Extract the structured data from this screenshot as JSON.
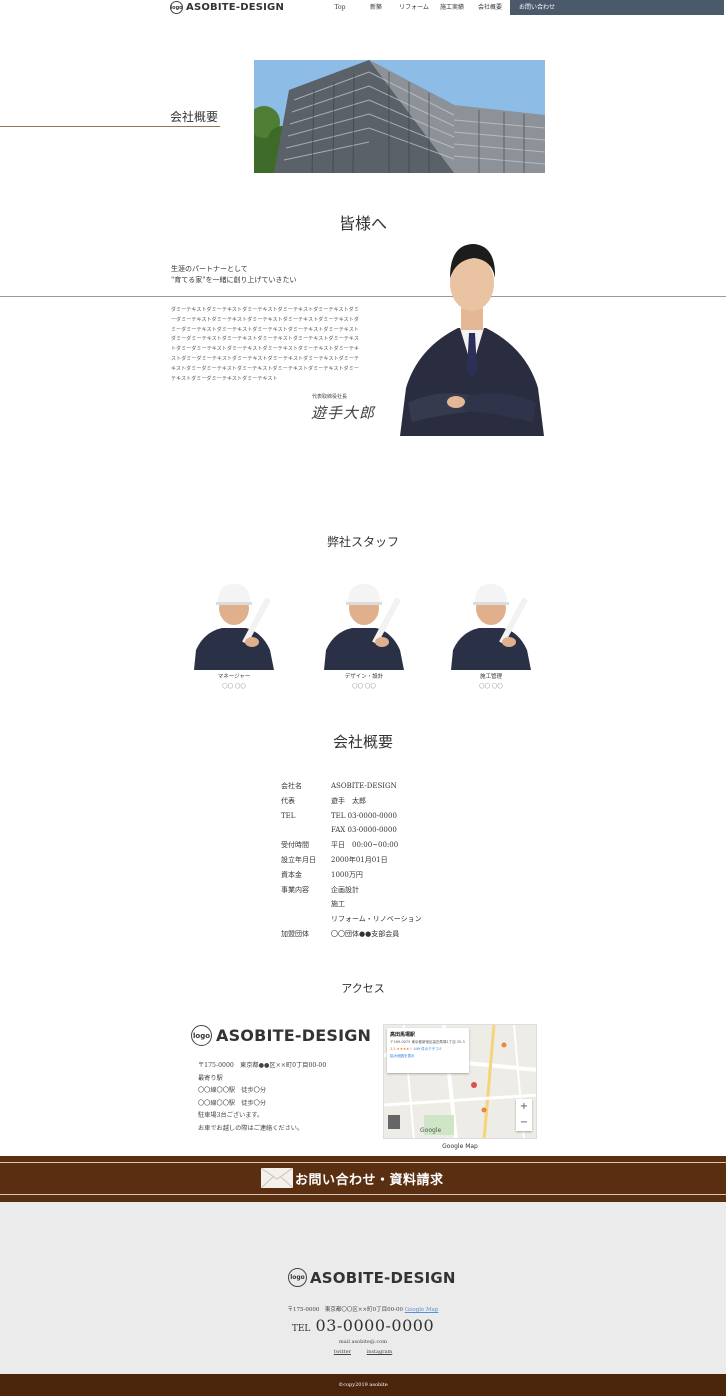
{
  "header": {
    "logo_mark": "logo",
    "logo_text": "ASOBITE-DESIGN",
    "nav": [
      "Top",
      "新築",
      "リフォーム",
      "施工実績",
      "会社概要"
    ],
    "contact": "お問い合わせ"
  },
  "hero": {
    "page_heading": "会社概要"
  },
  "greeting": {
    "title": "皆様へ",
    "sub_line1": "生涯のパートナーとして",
    "sub_line2": "\"育てる家\"を一緒に創り上げていきたい",
    "body": "ダミーテキストダミーテキストダミーテキストダミーテキストダミーテキストダミーダミーテキストダミーテキストダミーテキストダミーテキストダミーテキストダミーダミーテキストダミーテキストダミーテキストダミーテキストダミーテキストダミーダミーテキストダミーテキストダミーテキストダミーテキストダミーテキストダミーダミーテキストダミーテキストダミーテキストダミーテキストダミーテキストダミーダミーテキストダミーテキストダミーテキストダミーテキストダミーテキストダミーダミーテキストダミーテキストダミーテキストダミーテキストダミーテキストダミーダミーテキストダミーテキスト",
    "ceo_role": "代表取締役社長",
    "ceo_signature": "遊手大郎"
  },
  "staff": {
    "title": "弊社スタッフ",
    "members": [
      {
        "role": "マネージャー",
        "name": "〇〇 〇〇"
      },
      {
        "role": "デザイン・設計",
        "name": "〇〇 〇〇"
      },
      {
        "role": "施工管理",
        "name": "〇〇 〇〇"
      }
    ]
  },
  "company": {
    "title": "会社概要",
    "rows": [
      {
        "label": "会社名",
        "value": "ASOBITE-DESIGN"
      },
      {
        "label": "代表",
        "value": "遊手　太郎"
      },
      {
        "label": "TEL",
        "value": "TEL 03-0000-0000"
      },
      {
        "label": "",
        "value": "FAX 03-0000-0000"
      },
      {
        "label": "受付時間",
        "value": "平日　00:00~00:00"
      },
      {
        "label": "設立年月日",
        "value": "2000年01月01日"
      },
      {
        "label": "資本金",
        "value": "1000万円"
      },
      {
        "label": "事業内容",
        "value": "企画設計"
      },
      {
        "label": "",
        "value": "施工"
      },
      {
        "label": "",
        "value": "リフォーム・リノベーション"
      },
      {
        "label": "加盟団体",
        "value": "〇〇団体●●支部会員"
      }
    ]
  },
  "access": {
    "title": "アクセス",
    "logo_mark": "logo",
    "logo_text": "ASOBITE-DESIGN",
    "lines": [
      "〒175-0000　東京都●●区××町0丁目00-00",
      "最寄り駅",
      "〇〇線〇〇駅　徒歩〇分",
      "〇〇線〇〇駅　徒歩〇分",
      "駐車場3台ございます。",
      "お車でお越しの際はご連絡ください。"
    ],
    "map": {
      "place": "高田馬場駅",
      "address": "〒169-0075 東京都新宿区高田馬場1丁目 35-3",
      "rating": "3.5 ★★★★☆",
      "reviews": "449 件のクチコミ",
      "enlarge": "拡大地図を表示",
      "zoom_in": "+",
      "zoom_out": "−",
      "google": "Google",
      "caption": "Google Map"
    }
  },
  "contact_banner": {
    "label": "お問い合わせ・資料請求"
  },
  "footer": {
    "logo_mark": "logo",
    "logo_text": "ASOBITE-DESIGN",
    "address": "〒175-0000　東京都〇〇区××町0丁目00-00",
    "map_link": "Google Map",
    "tel_label": "TEL",
    "tel_number": "03-0000-0000",
    "email": "mail asobite@.com",
    "social": [
      "twitter",
      "instagram"
    ],
    "copyright": "©copy2019 asobite"
  }
}
